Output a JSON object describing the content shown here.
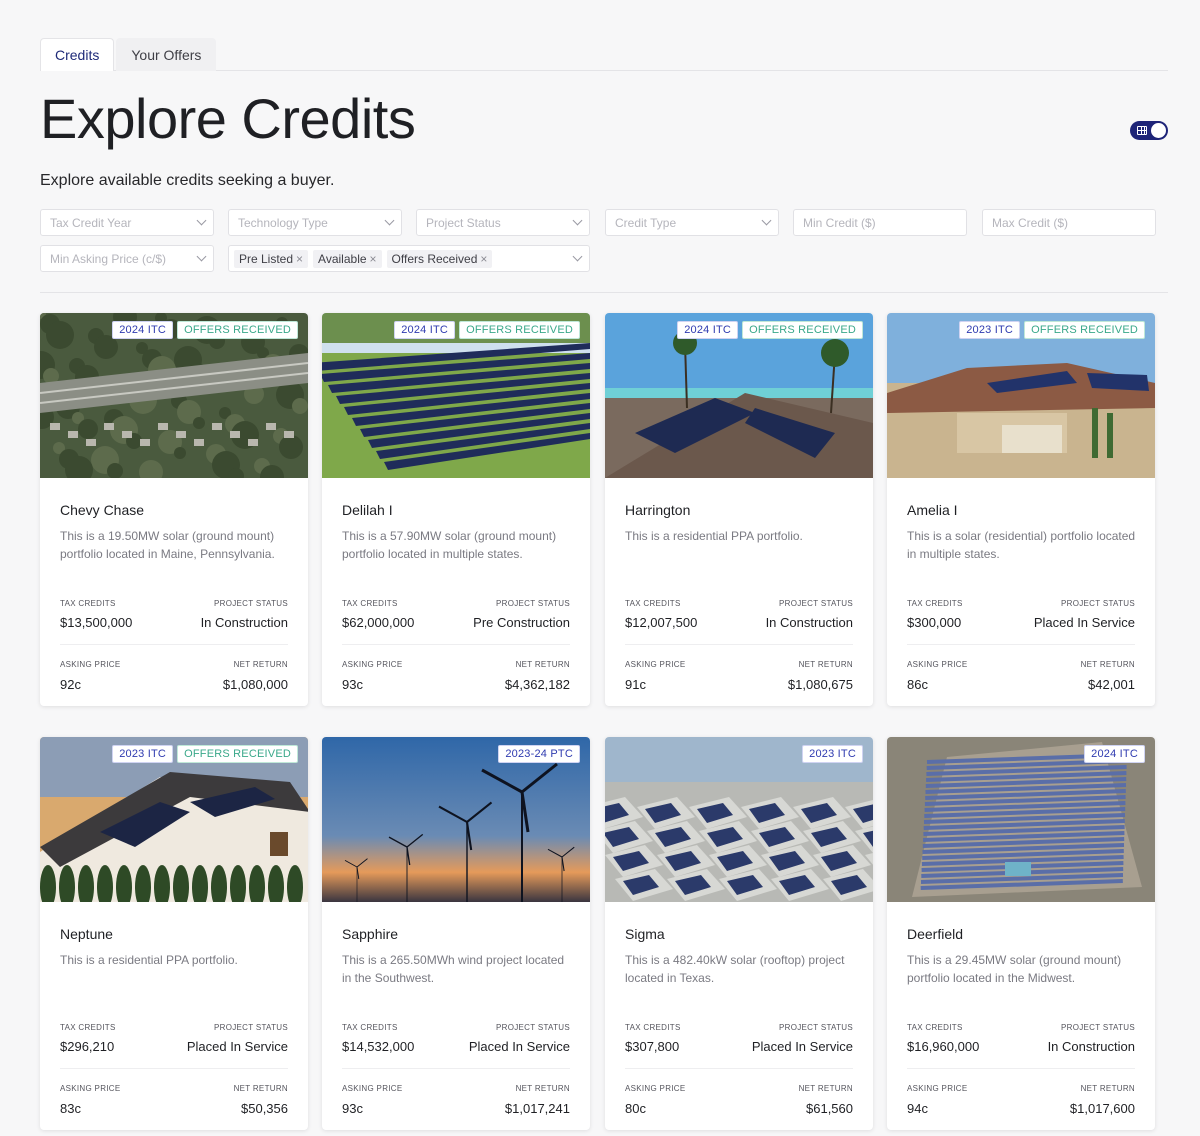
{
  "tabs": [
    {
      "label": "Credits",
      "active": true
    },
    {
      "label": "Your Offers",
      "active": false
    }
  ],
  "page": {
    "title": "Explore Credits",
    "subtitle": "Explore available credits seeking a buyer."
  },
  "view_toggle": {
    "icon": "grid-icon",
    "on": true,
    "color": "#1e2478"
  },
  "filters": {
    "tax_credit_year": "Tax Credit Year",
    "technology_type": "Technology Type",
    "project_status": "Project Status",
    "credit_type": "Credit Type",
    "min_credit": "Min Credit ($)",
    "max_credit": "Max Credit ($)",
    "min_asking_price": "Min Asking Price (c/$)",
    "status_chips": [
      "Pre Listed",
      "Available",
      "Offers Received"
    ]
  },
  "labels": {
    "tax_credits": "TAX CREDITS",
    "project_status": "PROJECT STATUS",
    "asking_price": "ASKING PRICE",
    "net_return": "NET RETURN"
  },
  "cards": [
    {
      "name": "Chevy Chase",
      "desc": "This is a 19.50MW solar (ground mount) portfolio located in Maine, Pennsylvania.",
      "credit_badge": "2024 ITC",
      "offers_badge": "OFFERS RECEIVED",
      "tax_credits": "$13,500,000",
      "project_status": "In Construction",
      "asking_price": "92c",
      "net_return": "$1,080,000",
      "image": "aerial-town"
    },
    {
      "name": "Delilah I",
      "desc": "This is a 57.90MW solar (ground mount) portfolio located in multiple states.",
      "credit_badge": "2024 ITC",
      "offers_badge": "OFFERS RECEIVED",
      "tax_credits": "$62,000,000",
      "project_status": "Pre Construction",
      "asking_price": "93c",
      "net_return": "$4,362,182",
      "image": "solar-field"
    },
    {
      "name": "Harrington",
      "desc": "This is a residential PPA portfolio.",
      "credit_badge": "2024 ITC",
      "offers_badge": "OFFERS RECEIVED",
      "tax_credits": "$12,007,500",
      "project_status": "In Construction",
      "asking_price": "91c",
      "net_return": "$1,080,675",
      "image": "beach-roof"
    },
    {
      "name": "Amelia I",
      "desc": "This is a solar (residential) portfolio located in multiple states.",
      "credit_badge": "2023 ITC",
      "offers_badge": "OFFERS RECEIVED",
      "tax_credits": "$300,000",
      "project_status": "Placed In Service",
      "asking_price": "86c",
      "net_return": "$42,001",
      "image": "desert-house"
    },
    {
      "name": "Neptune",
      "desc": "This is a residential PPA portfolio.",
      "credit_badge": "2023 ITC",
      "offers_badge": "OFFERS RECEIVED",
      "tax_credits": "$296,210",
      "project_status": "Placed In Service",
      "asking_price": "83c",
      "net_return": "$50,356",
      "image": "house-sunset"
    },
    {
      "name": "Sapphire",
      "desc": "This is a 265.50MWh wind project located in the Southwest.",
      "credit_badge": "2023-24 PTC",
      "offers_badge": "",
      "tax_credits": "$14,532,000",
      "project_status": "Placed In Service",
      "asking_price": "93c",
      "net_return": "$1,017,241",
      "image": "wind"
    },
    {
      "name": "Sigma",
      "desc": "This is a 482.40kW solar (rooftop) project located in Texas.",
      "credit_badge": "2023 ITC",
      "offers_badge": "",
      "tax_credits": "$307,800",
      "project_status": "Placed In Service",
      "asking_price": "80c",
      "net_return": "$61,560",
      "image": "rooftops"
    },
    {
      "name": "Deerfield",
      "desc": "This is a 29.45MW solar (ground mount) portfolio located in the Midwest.",
      "credit_badge": "2024 ITC",
      "offers_badge": "",
      "tax_credits": "$16,960,000",
      "project_status": "In Construction",
      "asking_price": "94c",
      "net_return": "$1,017,600",
      "image": "solar-farm-aerial"
    }
  ]
}
